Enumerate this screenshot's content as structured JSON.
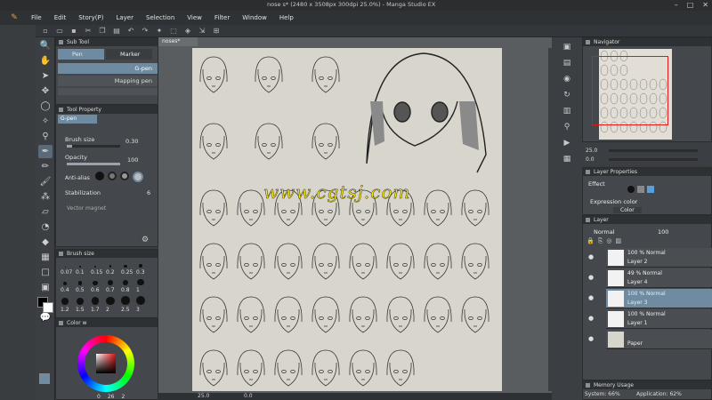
{
  "app": {
    "title": "nose s* (2480 x 3508px 300dpi 25.0%) - Manga Studio EX",
    "menu": [
      "File",
      "Edit",
      "Story(P)",
      "Layer",
      "Selection",
      "View",
      "Filter",
      "Window",
      "Help"
    ]
  },
  "document": {
    "tab_label": "noses*",
    "zoom": "25.0",
    "angle": "0.0"
  },
  "watermark": "www.cgtsj.com",
  "subtool": {
    "panel_title": "Sub Tool",
    "tabs": [
      "Pen",
      "Marker"
    ],
    "brushes": [
      "G-pen",
      "Mapping pen"
    ]
  },
  "tool_property": {
    "panel_title": "Tool Property",
    "brush_name": "G-pen",
    "brush_size_label": "Brush size",
    "brush_size_value": "0.30",
    "opacity_label": "Opacity",
    "opacity_value": "100",
    "opacity_level": 1.0,
    "antialias_label": "Anti-alias",
    "stabilization_label": "Stabilization",
    "stabilization_value": "6",
    "vector_magnet_label": "Vector magnet"
  },
  "brush_size": {
    "panel_title": "Brush size",
    "values": [
      "0.07",
      "0.1",
      "0.15",
      "0.2",
      "0.25",
      "0.3",
      "0.4",
      "0.5",
      "0.6",
      "0.7",
      "0.8",
      "1",
      "1.2",
      "1.5",
      "1.7",
      "2",
      "2.5",
      "3"
    ]
  },
  "color_wheel": {
    "panel_title": "Color w",
    "values": [
      "0",
      "26",
      "2"
    ],
    "main_color": "#000000",
    "sub_color": "#ffffff"
  },
  "navigator": {
    "panel_title": "Navigator",
    "zoom": "25.0",
    "angle": "0.0"
  },
  "layer_property": {
    "panel_title": "Layer Properties",
    "effect_label": "Effect",
    "expression_color_label": "Expression color",
    "expression_color_value": "Color"
  },
  "layers": {
    "panel_title": "Layer",
    "blend_mode": "Normal",
    "opacity": "100",
    "items": [
      {
        "pct": "100 %",
        "mode": "Normal",
        "name": "Layer 2",
        "selected": false
      },
      {
        "pct": "49 %",
        "mode": "Normal",
        "name": "Layer 4",
        "selected": false
      },
      {
        "pct": "100 %",
        "mode": "Normal",
        "name": "Layer 3",
        "selected": true
      },
      {
        "pct": "100 %",
        "mode": "Normal",
        "name": "Layer 1",
        "selected": false
      },
      {
        "pct": "",
        "mode": "",
        "name": "Paper",
        "selected": false
      }
    ]
  },
  "memory": {
    "panel_title": "Memory Usage",
    "system": "System: 66%",
    "application": "Application: 62%"
  }
}
